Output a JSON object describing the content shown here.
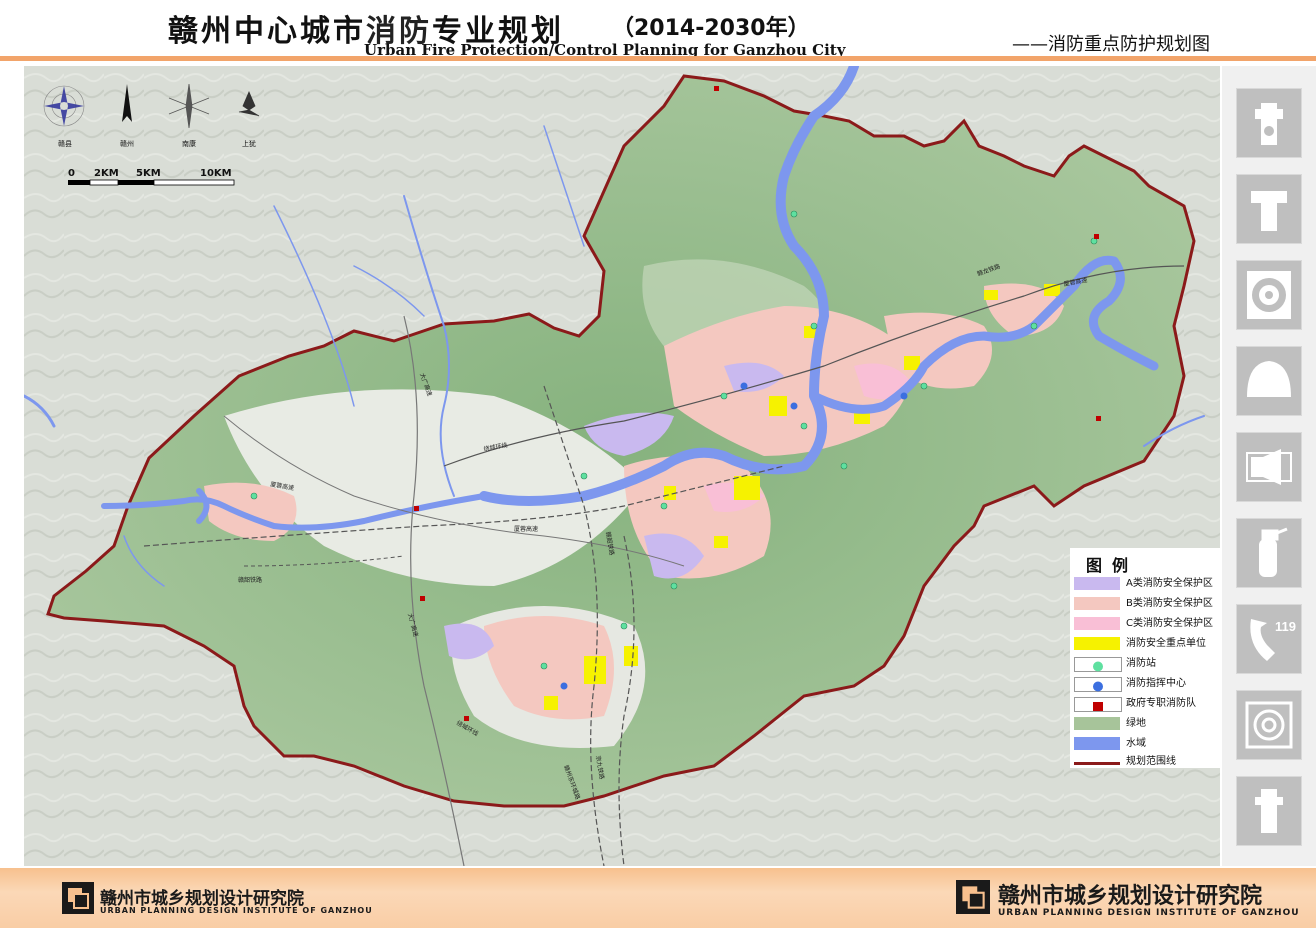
{
  "header": {
    "title_cn_1": "赣州中心城市",
    "title_cn_2": "消防",
    "title_cn_3": "专业规划",
    "title_years": "（2014-2030年）",
    "title_en": "Urban Fire Protection/Control Planning for Ganzhou City",
    "subtitle": "——消防重点防护规划图"
  },
  "compass": {
    "labels": [
      "赣县",
      "赣州",
      "南康",
      "上犹"
    ]
  },
  "scale_bar": {
    "ticks": [
      "0",
      "2KM",
      "5KM",
      "10KM"
    ]
  },
  "map_labels": {
    "roads": [
      "大广高速",
      "大广高速",
      "绕城环线",
      "绕城环线",
      "厦蓉高速",
      "厦蓉高速",
      "赣韶铁路",
      "赣韶铁路",
      "厦蓉高速",
      "赣龙铁路",
      "京九铁路",
      "赣州东环城路"
    ]
  },
  "legend": {
    "title": "图例",
    "items": [
      {
        "label": "A类消防安全保护区",
        "color": "#c9b9ef"
      },
      {
        "label": "B类消防安全保护区",
        "color": "#f4c8c0"
      },
      {
        "label": "C类消防安全保护区",
        "color": "#f9bfd6"
      },
      {
        "label": "消防安全重点单位",
        "color": "#f6f200"
      },
      {
        "label": "消防站",
        "color": "#5fe0a0"
      },
      {
        "label": "消防指挥中心",
        "color": "#3b6fe0"
      },
      {
        "label": "政府专职消防队",
        "color": "#c00000"
      },
      {
        "label": "绿地",
        "color": "#a7c49a"
      },
      {
        "label": "水域",
        "color": "#7d97ee"
      },
      {
        "label": "规划范围线",
        "color": "#8b1a1a"
      }
    ]
  },
  "side_icons": [
    "fire-hydrant-icon",
    "standpipe-icon",
    "hose-reel-icon",
    "helmet-icon",
    "alarm-horn-icon",
    "extinguisher-icon",
    "phone-119-icon",
    "hose-coil-icon",
    "pillar-hydrant-icon"
  ],
  "side_phone_number": "119",
  "footer": {
    "left_cn": "赣州市城乡规划设计研究院",
    "left_en": "URBAN PLANNING DESIGN INSTITUTE OF GANZHOU",
    "right_cn": "赣州市城乡规划设计研究院",
    "right_en": "URBAN PLANNING DESIGN INSTITUTE OF GANZHOU"
  }
}
